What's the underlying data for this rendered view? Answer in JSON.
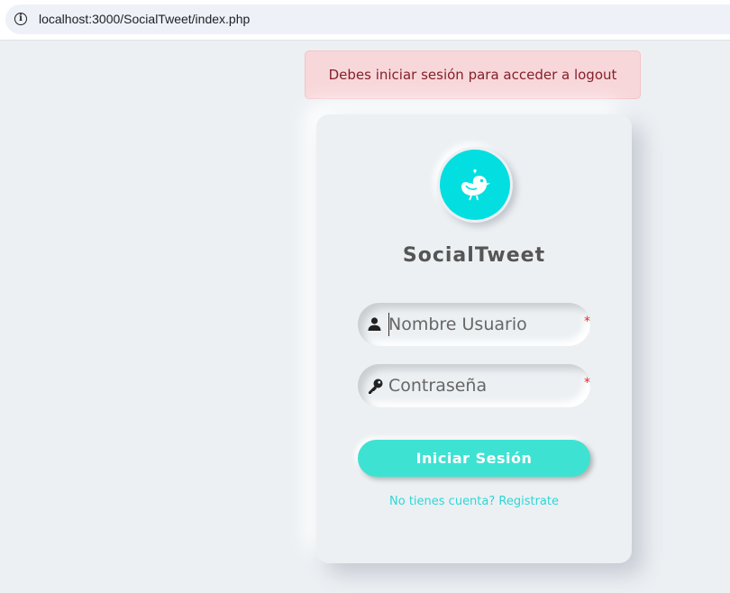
{
  "browser": {
    "url": "localhost:3000/SocialTweet/index.php",
    "info_icon": "info-icon"
  },
  "alert": {
    "message": "Debes iniciar sesión para acceder a logout",
    "background": "#f8d7da",
    "text_color": "#842029"
  },
  "login": {
    "logo_icon": "bird-icon",
    "logo_color": "#03dfe0",
    "brand": "SocialTweet",
    "username": {
      "placeholder": "Nombre Usuario",
      "value": "",
      "icon": "user-icon",
      "required_mark": "*"
    },
    "password": {
      "placeholder": "Contraseña",
      "value": "",
      "icon": "key-icon",
      "required_mark": "*"
    },
    "submit_label": "Iniciar Sesión",
    "submit_color": "#3ee2d2",
    "register_link": "No tienes cuenta? Registrate"
  }
}
